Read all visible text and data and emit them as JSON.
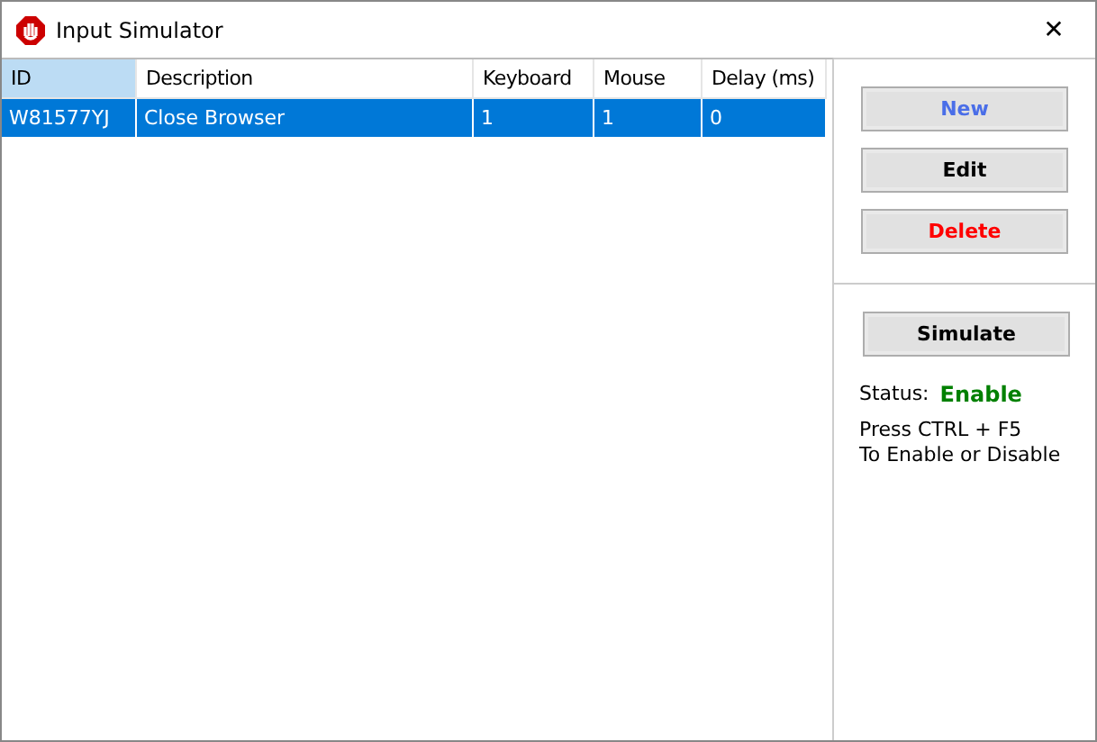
{
  "window": {
    "title": "Input Simulator",
    "close": "✕"
  },
  "table": {
    "columns": [
      {
        "label": "ID",
        "selected": true
      },
      {
        "label": "Description",
        "selected": false
      },
      {
        "label": "Keyboard",
        "selected": false
      },
      {
        "label": "Mouse",
        "selected": false
      },
      {
        "label": "Delay (ms)",
        "selected": false
      }
    ],
    "rows": [
      {
        "cells": [
          "W81577YJ",
          "Close Browser",
          "1",
          "1",
          "0"
        ],
        "selected": true
      }
    ]
  },
  "actions": [
    {
      "label": "New",
      "color": "#4a6ee8"
    },
    {
      "label": "Edit",
      "color": "#000000"
    },
    {
      "label": "Delete",
      "color": "#ff0000"
    }
  ],
  "simulate": {
    "label": "Simulate"
  },
  "status": {
    "label": "Status:",
    "value": "Enable",
    "color": "#008000"
  },
  "help": [
    "Press CTRL + F5",
    "To Enable or Disable"
  ]
}
